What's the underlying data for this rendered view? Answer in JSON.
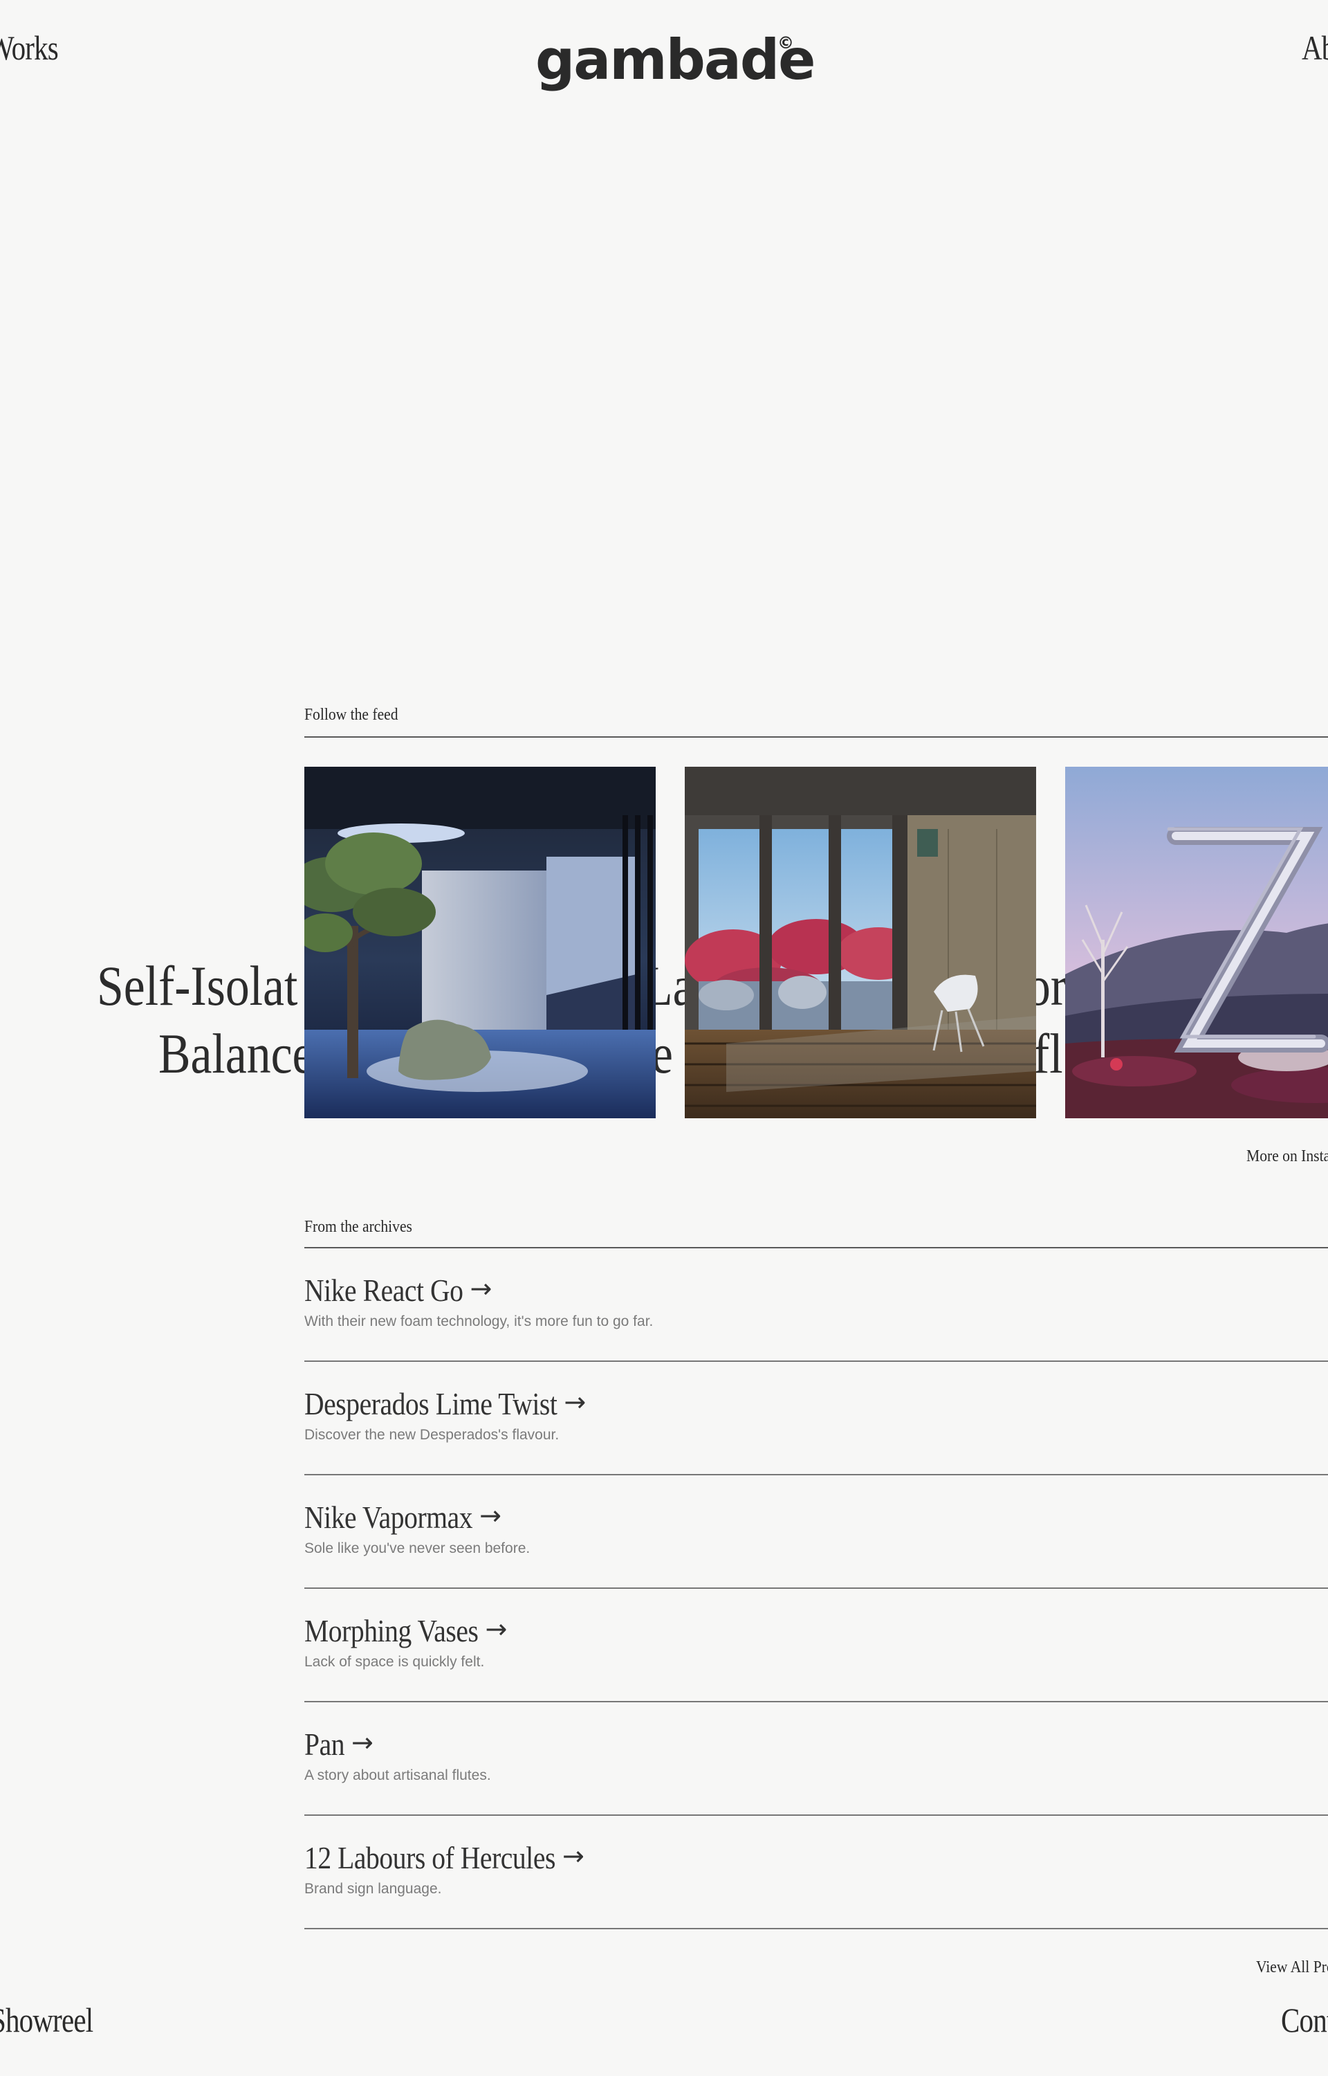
{
  "nav": {
    "works": "Works",
    "about": "About",
    "showreel": "Showreel",
    "contact": "Contact"
  },
  "brand": {
    "logo": "gambade",
    "mark": "©"
  },
  "hero": {
    "line1_left": "Self-Isolat",
    "line2_left": "Balance",
    "line1_mid": "La",
    "line2_mid": "e",
    "line1_right": "or",
    "line2_right": "fl"
  },
  "feed": {
    "label": "Follow the feed",
    "more": "More on Instagram",
    "images": [
      "tree-and-seat-room",
      "room-with-red-trees-and-chair",
      "chrome-z-in-pink-desert"
    ]
  },
  "archives": {
    "label": "From the archives",
    "arrow": "→",
    "projects": [
      {
        "title": "Nike React Go",
        "desc": "With their new foam technology, it's more fun to go far."
      },
      {
        "title": "Desperados Lime Twist",
        "desc": "Discover the new Desperados's flavour."
      },
      {
        "title": "Nike Vapormax",
        "desc": "Sole like you've never seen before."
      },
      {
        "title": "Morphing Vases",
        "desc": "Lack of space is quickly felt."
      },
      {
        "title": "Pan",
        "desc": "A story about artisanal flutes."
      },
      {
        "title": "12 Labours of Hercules",
        "desc": "Brand sign language."
      }
    ],
    "view_all": "View All Projects"
  },
  "colors": {
    "background": "#f7f7f6",
    "text": "#2a2a2a",
    "muted": "#7b7b7b"
  }
}
